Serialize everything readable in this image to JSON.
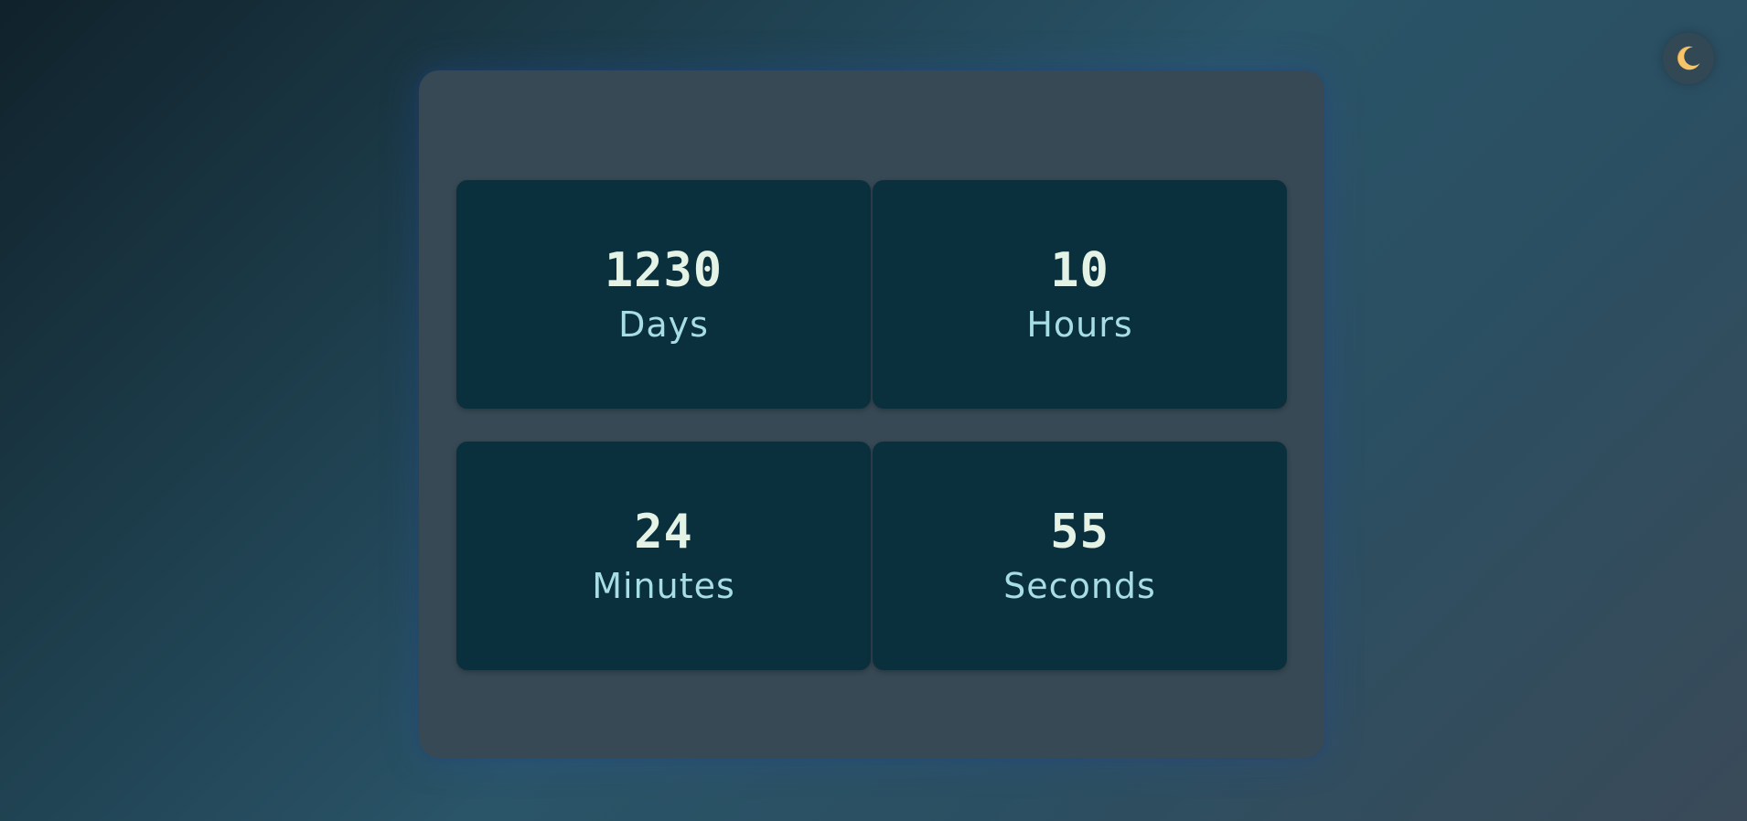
{
  "theme_toggle": {
    "icon": "crescent-moon-icon",
    "icon_color": "#f6c56b"
  },
  "countdown": {
    "days": {
      "value": "1230",
      "label": "Days"
    },
    "hours": {
      "value": "10",
      "label": "Hours"
    },
    "minutes": {
      "value": "24",
      "label": "Minutes"
    },
    "seconds": {
      "value": "55",
      "label": "Seconds"
    }
  },
  "colors": {
    "panel": "#364955",
    "card": "#0b303d",
    "value_text": "#e4f3e6",
    "label_text": "#a7dde4"
  }
}
